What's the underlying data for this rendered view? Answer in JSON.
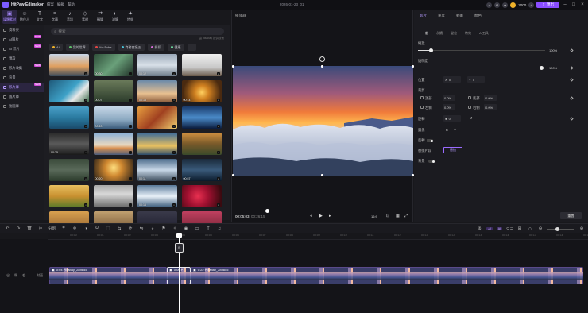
{
  "app": {
    "name": "HitPaw Edimakor",
    "menu": [
      "檔案",
      "編輯",
      "幫助"
    ],
    "doc_title": "2026-01-23_01",
    "credits": "2000",
    "export_label": "匯出"
  },
  "toolbar": [
    {
      "label": "媒體素材",
      "icon": "media-icon",
      "glyph": "▣",
      "active": true
    },
    {
      "label": "數位人",
      "icon": "avatar-icon",
      "glyph": "☺"
    },
    {
      "label": "文字",
      "icon": "text-icon",
      "glyph": "T"
    },
    {
      "label": "字幕",
      "icon": "subtitle-icon",
      "glyph": "≡"
    },
    {
      "label": "音訊",
      "icon": "audio-icon",
      "glyph": "♪"
    },
    {
      "label": "素材",
      "icon": "assets-icon",
      "glyph": "◇"
    },
    {
      "label": "轉場",
      "icon": "transition-icon",
      "glyph": "⇄"
    },
    {
      "label": "濾鏡",
      "icon": "filter-icon",
      "glyph": "◐"
    },
    {
      "label": "特效",
      "icon": "effects-icon",
      "glyph": "✦"
    }
  ],
  "leftnav": [
    {
      "label": "資料夾"
    },
    {
      "label": "AI圖片",
      "badge": "NEW"
    },
    {
      "label": "AI 影片",
      "badge": "NEW"
    },
    {
      "label": "預設"
    },
    {
      "label": "影片收集",
      "badge": "NEW"
    },
    {
      "label": "背景"
    },
    {
      "label": "影片庫",
      "active": true,
      "badge": "NEW"
    },
    {
      "label": "圖片庫"
    },
    {
      "label": "動圖庫"
    }
  ],
  "media": {
    "search_placeholder": "搜索",
    "provider": "由 pixabay 提供技術",
    "filters": [
      {
        "label": "AI",
        "color": "#f0b22a"
      },
      {
        "label": "我的世界",
        "color": "#5fbf6a"
      },
      {
        "label": "YouTube",
        "color": "#e64545"
      },
      {
        "label": "商務會議五",
        "color": "#4ac1d6"
      },
      {
        "label": "折扣",
        "color": "#d46bd6"
      },
      {
        "label": "健康",
        "color": "#6bd69c"
      }
    ],
    "thumbs": [
      {
        "dur": "",
        "bg": "linear-gradient(180deg,#c7d6e8 0%,#e0a060 55%,#3b4a5a 100%)"
      },
      {
        "dur": "00:30",
        "bg": "linear-gradient(135deg,#2f4f3a,#6aa07a 50%,#1e2e25)"
      },
      {
        "dur": "00:12",
        "bg": "linear-gradient(180deg,#9aa8b8,#d8e0e8 50%,#6c7a88)"
      },
      {
        "dur": "",
        "bg": "linear-gradient(180deg,#f0f0f0,#c8c8c8 60%,#6a5a4a)"
      },
      {
        "dur": "",
        "bg": "linear-gradient(135deg,#1f5a7a,#3ea2c8 50%,#e8e8e8 70%,#3a6a4a)"
      },
      {
        "dur": "00:07",
        "bg": "linear-gradient(180deg,#6a7a5a,#2a3a2a)"
      },
      {
        "dur": "00:13",
        "bg": "linear-gradient(180deg,#6a8aaa,#e8c090 60%,#8a5a3a)"
      },
      {
        "dur": "00:14",
        "bg": "radial-gradient(circle at 50% 55%,#ffd060 0%,#d08020 30%,#4a2a10 80%)"
      },
      {
        "dur": "",
        "bg": "linear-gradient(180deg,#4aa0c8,#2a7aa0 50%,#1a4a6a)"
      },
      {
        "dur": "00:20",
        "bg": "linear-gradient(180deg,#c8d8e8,#8aa8c0 60%,#3a5a7a)"
      },
      {
        "dur": "",
        "bg": "linear-gradient(135deg,#e8a040,#a04020 50%,#f0d070)"
      },
      {
        "dur": "",
        "bg": "linear-gradient(180deg,#1a3a6a,#4a8ac8 50%,#0a1a3a)"
      },
      {
        "dur": "00:25",
        "bg": "linear-gradient(180deg,#2a2a2a,#5a5a5a 50%,#1a1a1a)"
      },
      {
        "dur": "",
        "bg": "linear-gradient(180deg,#8ab0d8,#e8d8c0 55%,#d89050 70%,#4a5a7a)"
      },
      {
        "dur": "",
        "bg": "linear-gradient(180deg,#3a6a9a,#e8c060 60%,#2a4a6a)"
      },
      {
        "dur": "",
        "bg": "linear-gradient(180deg,#d09040,#7a5a2a 50%,#3a4a2a)"
      },
      {
        "dur": "",
        "bg": "linear-gradient(180deg,#3a4a3a,#5a6a5a 50%,#2a3a2a)"
      },
      {
        "dur": "00:20",
        "bg": "radial-gradient(circle at 50% 40%,#ffe080 0%,#d08830 35%,#3a2a1a 90%)"
      },
      {
        "dur": "00:11",
        "bg": "linear-gradient(180deg,#4a6a8a,#c8d8e8 50%,#3a4a5a)"
      },
      {
        "dur": "00:57",
        "bg": "linear-gradient(180deg,#1a2a3a,#3a5a7a 50%,#0a1a2a)"
      },
      {
        "dur": "",
        "bg": "linear-gradient(180deg,#e8c060,#c89030 50%,#5a7a2a)"
      },
      {
        "dur": "",
        "bg": "linear-gradient(180deg,#a8a8a8,#d8d8d8 40%,#6a6a6a)"
      },
      {
        "dur": "00:16",
        "bg": "linear-gradient(180deg,#5a7a9a,#e8f0f8 50%,#3a5a7a)"
      },
      {
        "dur": "",
        "bg": "radial-gradient(circle at 40% 50%,#e83050 0%,#a01030 40%,#3a0a10 90%)"
      },
      {
        "dur": "",
        "bg": "linear-gradient(180deg,#d8a050,#8a5a2a)"
      },
      {
        "dur": "",
        "bg": "linear-gradient(180deg,#c0a070,#6a4a2a)"
      },
      {
        "dur": "",
        "bg": "linear-gradient(180deg,#3a3a4a,#1a1a2a)"
      },
      {
        "dur": "",
        "bg": "linear-gradient(180deg,#c04060,#6a2030)"
      }
    ]
  },
  "player": {
    "title": "播放器",
    "time_current": "00:05:03",
    "time_total": "00:26:15",
    "ratio": "16:9"
  },
  "props": {
    "tabs": [
      "影片",
      "速度",
      "動畫",
      "顏色"
    ],
    "subtabs": [
      "一般",
      "永續",
      "變化",
      "特效",
      "AI工具"
    ],
    "scale_label": "縮放",
    "scale_value": "100%",
    "scale_level": 0.1,
    "opacity_label": "透明度",
    "opacity_value": "100%",
    "opacity_level": 0.97,
    "position_label": "位置",
    "pos_x_label": "X",
    "pos_x": "0",
    "pos_y_label": "Y",
    "pos_y": "0",
    "crop_label": "裁剪",
    "crop_left_label": "頂部",
    "crop_left": "0.0%",
    "crop_top_label": "底部",
    "crop_top": "0.0%",
    "crop_right_label": "左側",
    "crop_right": "0.0%",
    "crop_bottom_label": "右側",
    "crop_bottom": "0.0%",
    "rotate_label": "旋轉",
    "rotate_value": "0",
    "flip_label": "鏡像",
    "stabilize_label": "反轉",
    "replace_label": "替換片段",
    "replace_btn": "替換",
    "bg_label": "背景",
    "reset_label": "重置"
  },
  "timeline": {
    "ruler": [
      "00:00",
      "00:01",
      "00:02",
      "00:03",
      "00:04",
      "00:05",
      "00:06",
      "00:07",
      "00:08",
      "00:09",
      "00:10",
      "00:11",
      "00:12",
      "00:13",
      "00:14",
      "00:15",
      "00:16",
      "00:17",
      "00:18",
      "00:19"
    ],
    "track_label": "封面",
    "clips": [
      {
        "name": "0:04 Pixabay_289855"
      },
      {
        "name": "0:00 P"
      },
      {
        "name": "0:22 Pixabay_289855"
      }
    ],
    "split_label": "分割",
    "playhead_marker": "◎"
  }
}
